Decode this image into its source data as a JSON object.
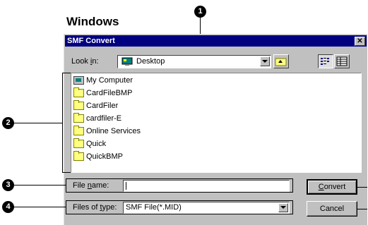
{
  "heading": "Windows",
  "callouts": [
    "1",
    "2",
    "3",
    "4"
  ],
  "dialog": {
    "title": "SMF Convert",
    "close_glyph": "✕",
    "look_in_label_pre": "Look ",
    "look_in_label_key": "i",
    "look_in_label_post": "n:",
    "look_in_value": "Desktop",
    "file_name_label_pre": "File ",
    "file_name_label_key": "n",
    "file_name_label_post": "ame:",
    "file_name_value": "",
    "files_of_type_label_pre": "Files of ",
    "files_of_type_label_key": "t",
    "files_of_type_label_post": "ype:",
    "files_of_type_value": "SMF File(*.MID)",
    "convert_button_key": "C",
    "convert_button_rest": "onvert",
    "cancel_button": "Cancel",
    "items": [
      {
        "name": "My Computer",
        "icon": "computer-icon"
      },
      {
        "name": "CardFileBMP",
        "icon": "folder-icon"
      },
      {
        "name": "CardFiler",
        "icon": "folder-icon"
      },
      {
        "name": "cardfiler-E",
        "icon": "folder-icon"
      },
      {
        "name": "Online Services",
        "icon": "folder-icon"
      },
      {
        "name": "Quick",
        "icon": "folder-icon"
      },
      {
        "name": "QuickBMP",
        "icon": "folder-icon"
      }
    ]
  }
}
